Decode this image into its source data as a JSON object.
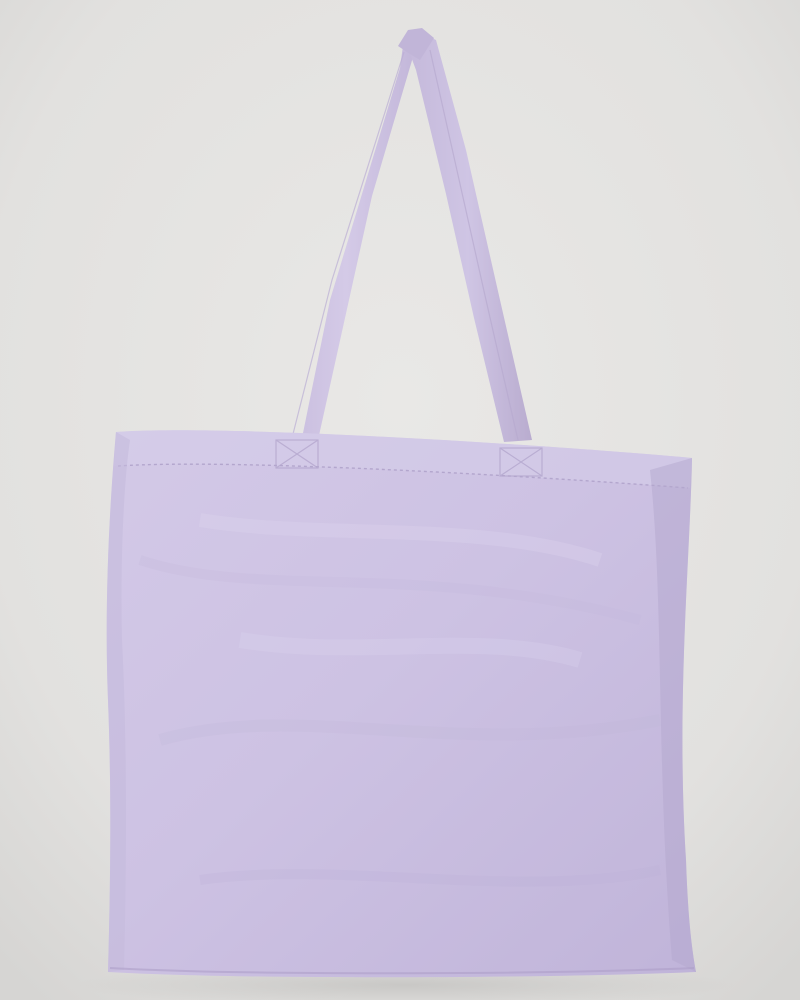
{
  "photo": {
    "subject": "tote-bag",
    "colors": {
      "background": "#e4e3e1",
      "background_shadow": "#d2d1cf",
      "bag_fabric": "#cdc2e3",
      "bag_fabric_light": "#d9d0ea",
      "bag_fabric_shadow": "#b5a9cf",
      "strap": "#c9bedf",
      "stitching": "#b1a4cc"
    }
  }
}
